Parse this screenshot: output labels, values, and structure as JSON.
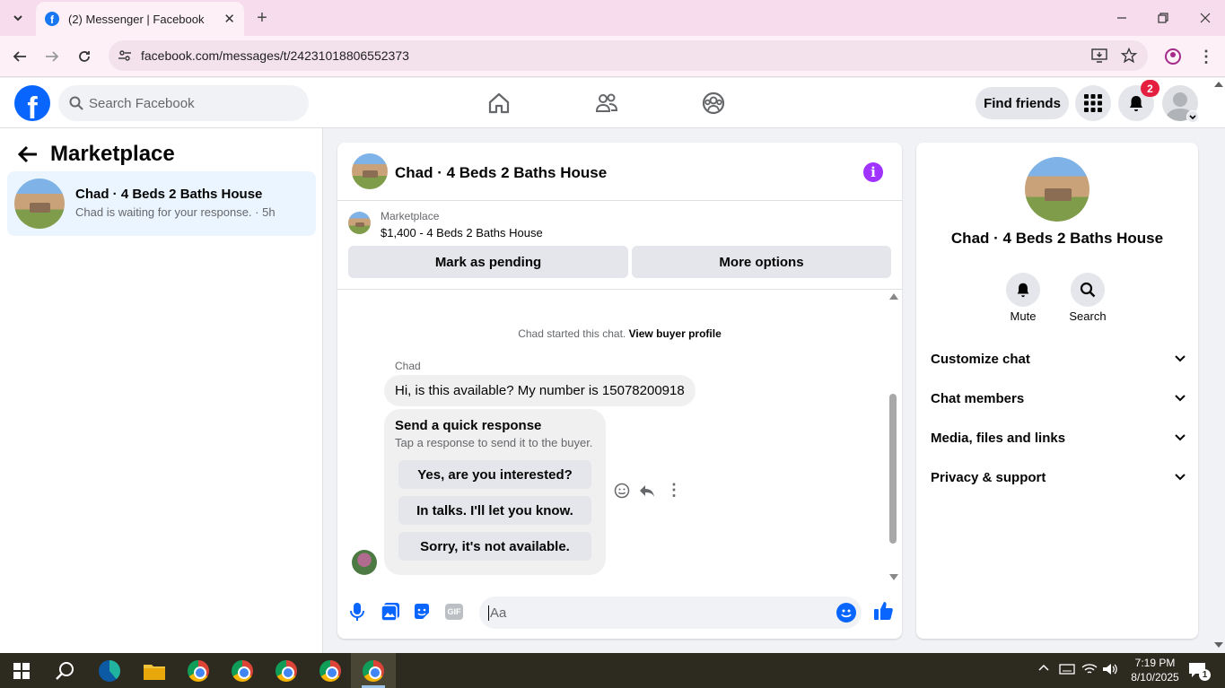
{
  "browser": {
    "tab_title": "(2) Messenger | Facebook",
    "url": "facebook.com/messages/t/24231018806552373"
  },
  "header": {
    "search_placeholder": "Search Facebook",
    "find_friends": "Find friends",
    "notification_count": "2"
  },
  "left_panel": {
    "title": "Marketplace",
    "conversation": {
      "name": "Chad · 4 Beds 2 Baths House",
      "preview": "Chad is waiting for your response. · 5h"
    }
  },
  "chat": {
    "title": "Chad · 4 Beds 2 Baths House",
    "listing_source": "Marketplace",
    "listing": "$1,400 - 4 Beds 2 Baths House",
    "mark_pending": "Mark as pending",
    "more_options": "More options",
    "started_text": "Chad started this chat.",
    "buyer_profile_link": "View buyer profile",
    "sender_name": "Chad",
    "message": "Hi, is this available? My number is 15078200918",
    "quick_title": "Send a quick response",
    "quick_subtitle": "Tap a response to send it to the buyer.",
    "quick_responses": [
      "Yes, are you interested?",
      "In talks. I'll let you know.",
      "Sorry, it's not available."
    ],
    "composer_placeholder": "Aa"
  },
  "right_panel": {
    "name": "Chad · 4 Beds 2 Baths House",
    "mute_label": "Mute",
    "search_label": "Search",
    "menu": [
      "Customize chat",
      "Chat members",
      "Media, files and links",
      "Privacy & support"
    ]
  },
  "taskbar": {
    "time": "7:19 PM",
    "date": "8/10/2025",
    "notification_count": "1"
  },
  "colors": {
    "fb_blue": "#0866ff",
    "messenger_purple": "#a033ff",
    "selected_bg": "#ebf5ff",
    "badge_red": "#e41e3f"
  }
}
